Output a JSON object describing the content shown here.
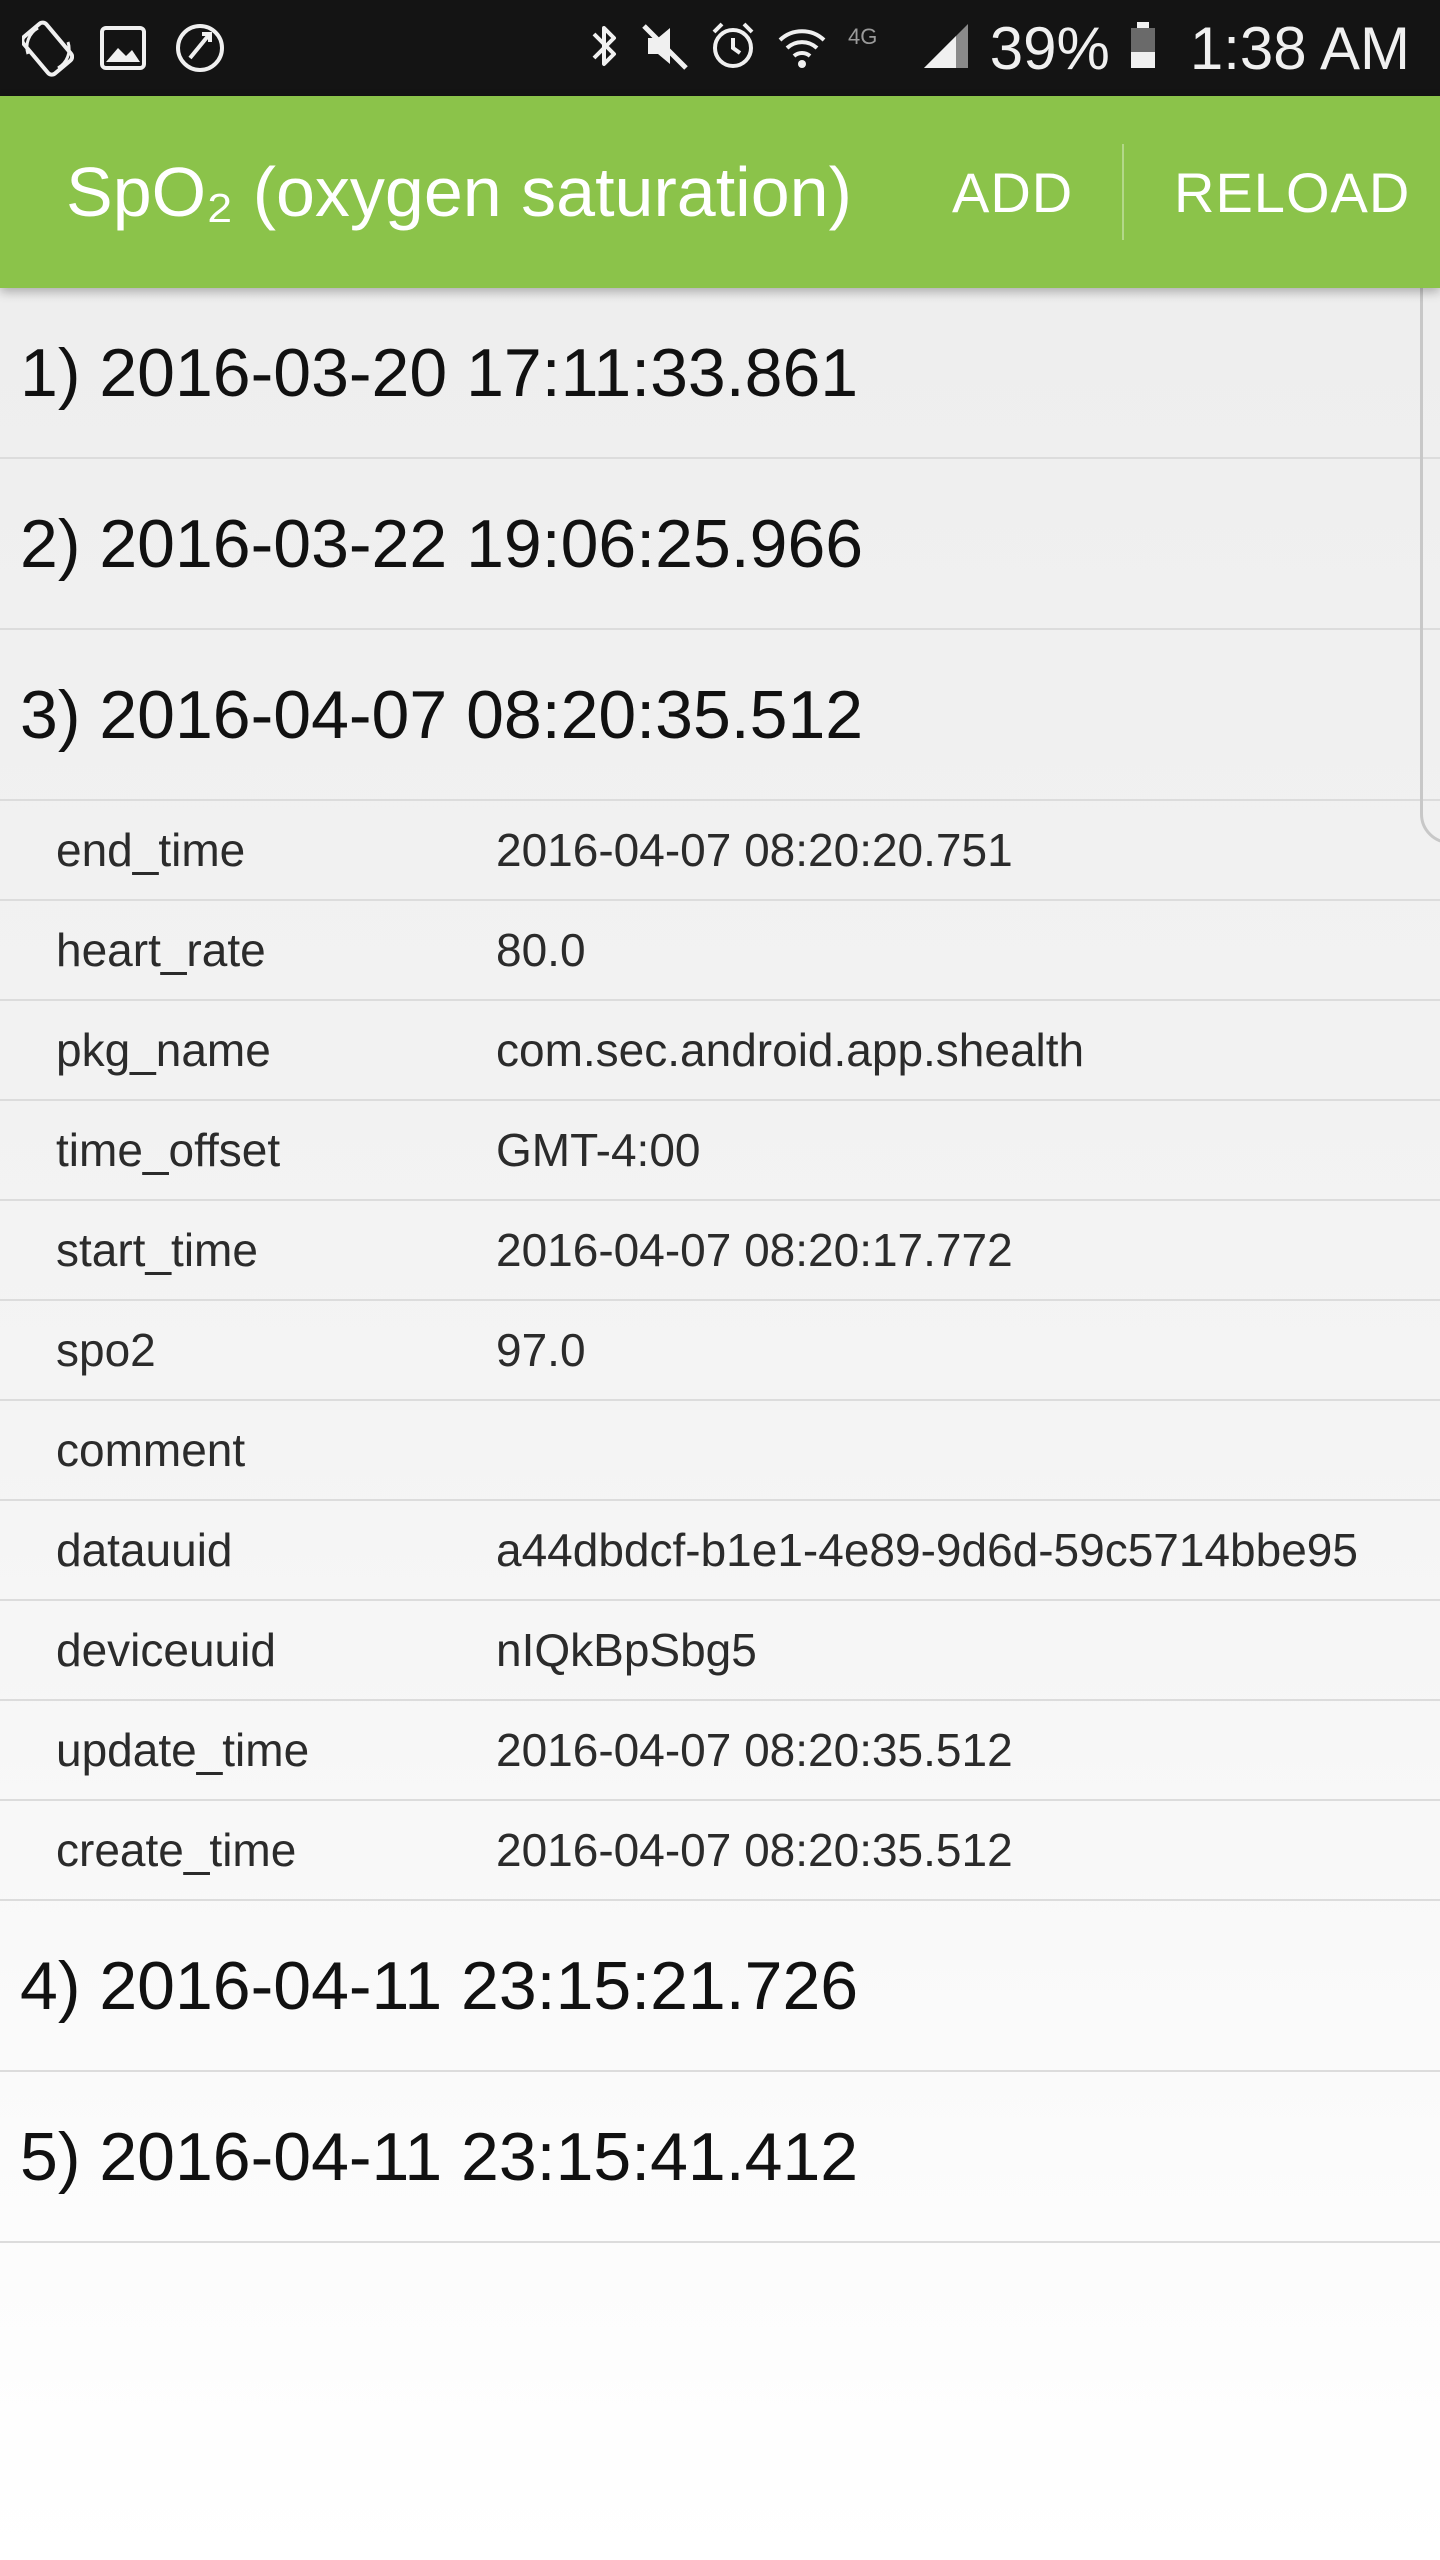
{
  "status_bar": {
    "left_icons": [
      "rotate-lock-icon",
      "image-icon",
      "data-saver-icon"
    ],
    "right_icons": [
      "bluetooth-icon",
      "mute-icon",
      "alarm-icon",
      "wifi-icon",
      "network-4g-icon",
      "signal-icon",
      "battery-icon"
    ],
    "network_label": "4G",
    "battery": "39%",
    "time": "1:38 AM"
  },
  "action_bar": {
    "title": "SpO₂ (oxygen saturation)",
    "add_label": "ADD",
    "reload_label": "RELOAD",
    "color": "#8bc34a"
  },
  "records": [
    {
      "label": "1) 2016-03-20 17:11:33.861"
    },
    {
      "label": "2) 2016-03-22 19:06:25.966"
    },
    {
      "label": "3) 2016-04-07 08:20:35.512"
    },
    {
      "label": "4) 2016-04-11 23:15:21.726"
    },
    {
      "label": "5) 2016-04-11 23:15:41.412"
    }
  ],
  "expanded_details": [
    {
      "key": "end_time",
      "value": "2016-04-07 08:20:20.751"
    },
    {
      "key": "heart_rate",
      "value": "80.0"
    },
    {
      "key": "pkg_name",
      "value": "com.sec.android.app.shealth"
    },
    {
      "key": "time_offset",
      "value": "GMT-4:00"
    },
    {
      "key": "start_time",
      "value": "2016-04-07 08:20:17.772"
    },
    {
      "key": "spo2",
      "value": "97.0"
    },
    {
      "key": "comment",
      "value": ""
    },
    {
      "key": "datauuid",
      "value": "a44dbdcf-b1e1-4e89-9d6d-59c5714bbe95"
    },
    {
      "key": "deviceuuid",
      "value": "nIQkBpSbg5"
    },
    {
      "key": "update_time",
      "value": "2016-04-07 08:20:35.512"
    },
    {
      "key": "create_time",
      "value": "2016-04-07 08:20:35.512"
    }
  ]
}
